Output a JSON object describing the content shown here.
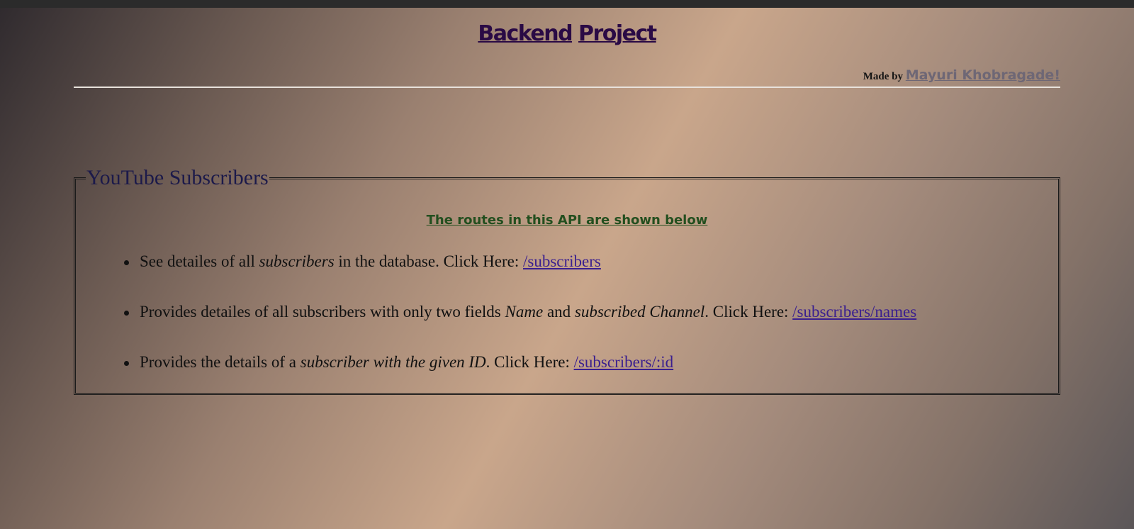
{
  "header": {
    "title_word1": "Backend",
    "title_word2": "Project",
    "made_by_label": "Made by",
    "author": "Mayuri Khobragade!"
  },
  "section": {
    "legend": "YouTube Subscribers",
    "heading": "The routes in this API are shown below",
    "routes": [
      {
        "text_before": "See detailes of all ",
        "italic1": "subscribers",
        "text_middle": " in the database. Click Here: ",
        "link": "/subscribers"
      },
      {
        "text_before": "Provides detailes of all subscribers with only two fields ",
        "italic1": "Name",
        "text_and": " and ",
        "italic2": "subscribed Channel",
        "text_middle": ". Click Here: ",
        "link": "/subscribers/names"
      },
      {
        "text_before": "Provides the details of a ",
        "italic1": "subscriber with the given ID",
        "text_middle": ". Click Here: ",
        "link": "/subscribers/:id"
      }
    ]
  },
  "colors": {
    "title": "#2a0a45",
    "heading": "#234f1f",
    "link": "#3a1f8f",
    "author": "#6e6775"
  }
}
